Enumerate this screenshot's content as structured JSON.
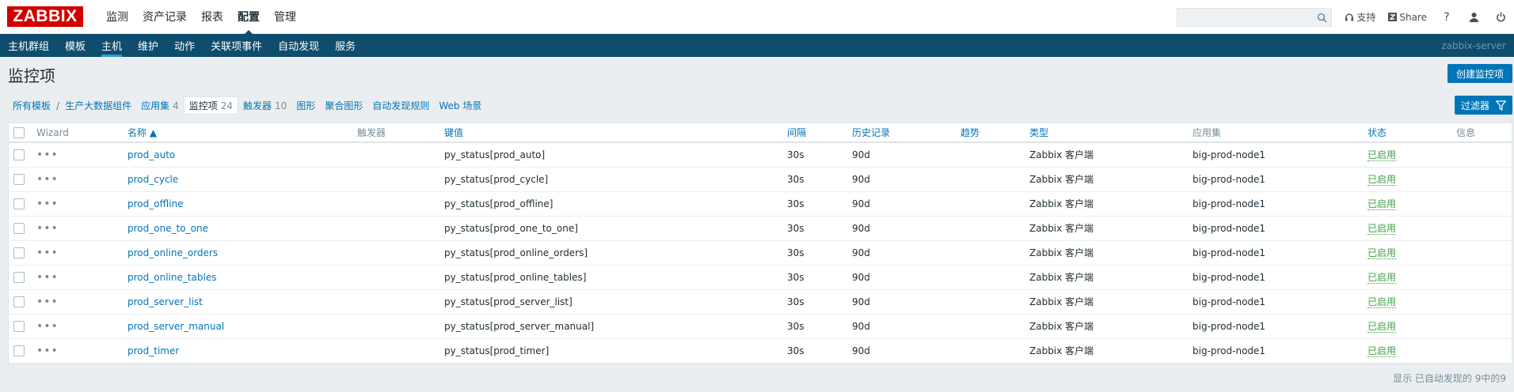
{
  "logo": "ZABBIX",
  "main_nav": [
    "监测",
    "资产记录",
    "报表",
    "配置",
    "管理"
  ],
  "search": {
    "placeholder": ""
  },
  "top_links": {
    "support": "支持",
    "share": "Share",
    "help": "?"
  },
  "sub_nav": [
    "主机群组",
    "模板",
    "主机",
    "维护",
    "动作",
    "关联项事件",
    "自动发现",
    "服务"
  ],
  "server_name": "zabbix-server",
  "page_title": "监控项",
  "create_button": "创建监控项",
  "breadcrumb": {
    "all_templates": "所有模板",
    "separator": "/",
    "host": "生产大数据组件",
    "tabs": [
      {
        "label": "应用集",
        "count": "4"
      },
      {
        "label": "监控项",
        "count": "24"
      },
      {
        "label": "触发器",
        "count": "10"
      },
      {
        "label": "图形",
        "count": ""
      },
      {
        "label": "聚合图形",
        "count": ""
      },
      {
        "label": "自动发现规则",
        "count": ""
      },
      {
        "label": "Web 场景",
        "count": ""
      }
    ]
  },
  "filter_button": "过滤器",
  "table": {
    "columns": [
      "Wizard",
      "名称 ▲",
      "触发器",
      "键值",
      "间隔",
      "历史记录",
      "趋势",
      "类型",
      "应用集",
      "状态",
      "信息"
    ],
    "rows": [
      {
        "name": "prod_auto",
        "key": "py_status[prod_auto]",
        "interval": "30s",
        "history": "90d",
        "trends": "",
        "type": "Zabbix 客户端",
        "application": "big-prod-node1",
        "status": "已启用"
      },
      {
        "name": "prod_cycle",
        "key": "py_status[prod_cycle]",
        "interval": "30s",
        "history": "90d",
        "trends": "",
        "type": "Zabbix 客户端",
        "application": "big-prod-node1",
        "status": "已启用"
      },
      {
        "name": "prod_offline",
        "key": "py_status[prod_offline]",
        "interval": "30s",
        "history": "90d",
        "trends": "",
        "type": "Zabbix 客户端",
        "application": "big-prod-node1",
        "status": "已启用"
      },
      {
        "name": "prod_one_to_one",
        "key": "py_status[prod_one_to_one]",
        "interval": "30s",
        "history": "90d",
        "trends": "",
        "type": "Zabbix 客户端",
        "application": "big-prod-node1",
        "status": "已启用"
      },
      {
        "name": "prod_online_orders",
        "key": "py_status[prod_online_orders]",
        "interval": "30s",
        "history": "90d",
        "trends": "",
        "type": "Zabbix 客户端",
        "application": "big-prod-node1",
        "status": "已启用"
      },
      {
        "name": "prod_online_tables",
        "key": "py_status[prod_online_tables]",
        "interval": "30s",
        "history": "90d",
        "trends": "",
        "type": "Zabbix 客户端",
        "application": "big-prod-node1",
        "status": "已启用"
      },
      {
        "name": "prod_server_list",
        "key": "py_status[prod_server_list]",
        "interval": "30s",
        "history": "90d",
        "trends": "",
        "type": "Zabbix 客户端",
        "application": "big-prod-node1",
        "status": "已启用"
      },
      {
        "name": "prod_server_manual",
        "key": "py_status[prod_server_manual]",
        "interval": "30s",
        "history": "90d",
        "trends": "",
        "type": "Zabbix 客户端",
        "application": "big-prod-node1",
        "status": "已启用"
      },
      {
        "name": "prod_timer",
        "key": "py_status[prod_timer]",
        "interval": "30s",
        "history": "90d",
        "trends": "",
        "type": "Zabbix 客户端",
        "application": "big-prod-node1",
        "status": "已启用"
      }
    ]
  },
  "footer_text": "显示 已自动发现的 9中的9",
  "colors": {
    "brand": "#d40000",
    "nav": "#0e4d6e",
    "link": "#0275b8",
    "enabled": "#429e47"
  }
}
